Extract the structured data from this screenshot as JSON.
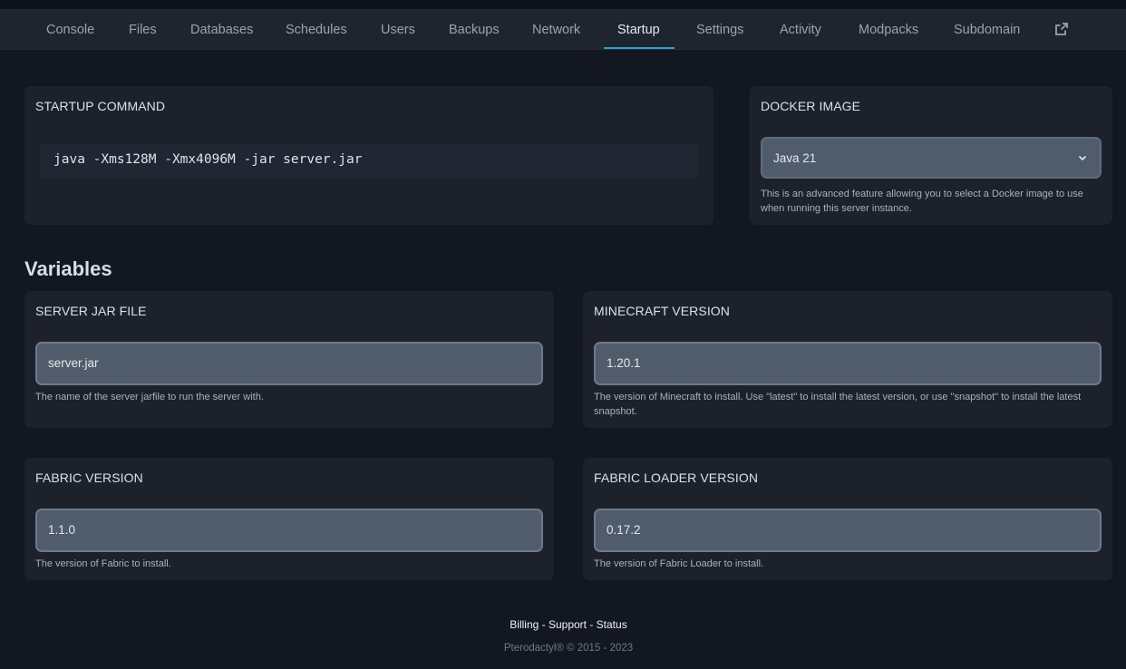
{
  "nav": {
    "tabs": [
      {
        "label": "Console"
      },
      {
        "label": "Files"
      },
      {
        "label": "Databases"
      },
      {
        "label": "Schedules"
      },
      {
        "label": "Users"
      },
      {
        "label": "Backups"
      },
      {
        "label": "Network"
      },
      {
        "label": "Startup",
        "active": true
      },
      {
        "label": "Settings"
      },
      {
        "label": "Activity"
      },
      {
        "label": "Modpacks"
      },
      {
        "label": "Subdomain"
      }
    ],
    "external_icon": "external-link-icon"
  },
  "startup": {
    "title": "STARTUP COMMAND",
    "command": "java -Xms128M -Xmx4096M -jar server.jar"
  },
  "docker": {
    "title": "DOCKER IMAGE",
    "selected": "Java 21",
    "description": "This is an advanced feature allowing you to select a Docker image to use when running this server instance."
  },
  "variables": {
    "heading": "Variables",
    "items": [
      {
        "title": "SERVER JAR FILE",
        "value": "server.jar",
        "description": "The name of the server jarfile to run the server with."
      },
      {
        "title": "MINECRAFT VERSION",
        "value": "1.20.1",
        "description": "The version of Minecraft to install. Use \"latest\" to install the latest version, or use \"snapshot\" to install the latest snapshot."
      },
      {
        "title": "FABRIC VERSION",
        "value": "1.1.0",
        "description": "The version of Fabric to install."
      },
      {
        "title": "FABRIC LOADER VERSION",
        "value": "0.17.2",
        "description": "The version of Fabric Loader to install."
      }
    ]
  },
  "footer": {
    "links": [
      "Billing",
      "Support",
      "Status"
    ],
    "separator": " - ",
    "copyright": "Pterodactyl® © 2015 - 2023"
  },
  "colors": {
    "background": "#131722",
    "navbar": "#1e252f",
    "card": "#1d212c",
    "accent": "#2a9fd6",
    "input": "#505c6b"
  }
}
